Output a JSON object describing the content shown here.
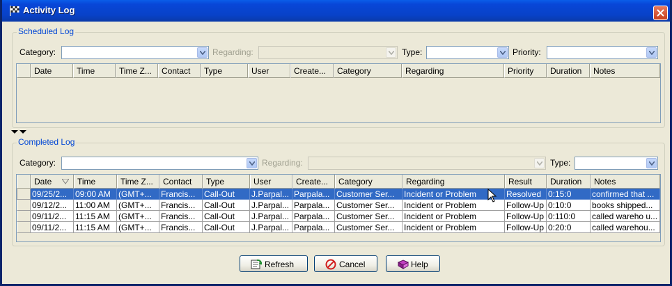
{
  "window": {
    "title": "Activity Log"
  },
  "scheduled": {
    "group_label": "Scheduled Log",
    "filters": {
      "category_label": "Category:",
      "regarding_label": "Regarding:",
      "type_label": "Type:",
      "priority_label": "Priority:"
    },
    "columns": [
      "Date",
      "Time",
      "Time Z...",
      "Contact",
      "Type",
      "User",
      "Create...",
      "Category",
      "Regarding",
      "Priority",
      "Duration",
      "Notes"
    ]
  },
  "completed": {
    "group_label": "Completed Log",
    "filters": {
      "category_label": "Category:",
      "regarding_label": "Regarding:",
      "type_label": "Type:"
    },
    "columns": [
      "Date",
      "Time",
      "Time Z...",
      "Contact",
      "Type",
      "User",
      "Create...",
      "Category",
      "Regarding",
      "Result",
      "Duration",
      "Notes"
    ],
    "rows": [
      [
        "09/25/2...",
        "09:00 AM",
        "(GMT+...",
        "Francis...",
        "Call-Out",
        "J.Parpal...",
        "Parpala...",
        "Customer Ser...",
        "Incident or Problem",
        "Resolved",
        "0:15:0",
        "confirmed that ..."
      ],
      [
        "09/12/2...",
        "11:00 AM",
        "(GMT+...",
        "Francis...",
        "Call-Out",
        "J.Parpal...",
        "Parpala...",
        "Customer Ser...",
        "Incident or Problem",
        "Follow-Up",
        "0:10:0",
        "books shipped..."
      ],
      [
        "09/11/2...",
        "11:15 AM",
        "(GMT+...",
        "Francis...",
        "Call-Out",
        "J.Parpal...",
        "Parpala...",
        "Customer Ser...",
        "Incident or Problem",
        "Follow-Up",
        "0:110:0",
        "called wareho u..."
      ],
      [
        "09/11/2...",
        "11:15 AM",
        "(GMT+...",
        "Francis...",
        "Call-Out",
        "J.Parpal...",
        "Parpala...",
        "Customer Ser...",
        "Incident or Problem",
        "Follow-Up",
        "0:20:0",
        "called warehou..."
      ]
    ],
    "selected_row": 0
  },
  "buttons": {
    "refresh": "Refresh",
    "cancel": "Cancel",
    "help": "Help"
  },
  "icons": {
    "app": "checkered-flag-icon",
    "close": "close-icon",
    "refresh": "refresh-icon",
    "cancel": "cancel-icon",
    "help": "help-book-icon"
  },
  "colors": {
    "titlebar": "#0846d8",
    "selection": "#316ac5",
    "group_label": "#0046d5",
    "window_bg": "#ece9d8"
  }
}
